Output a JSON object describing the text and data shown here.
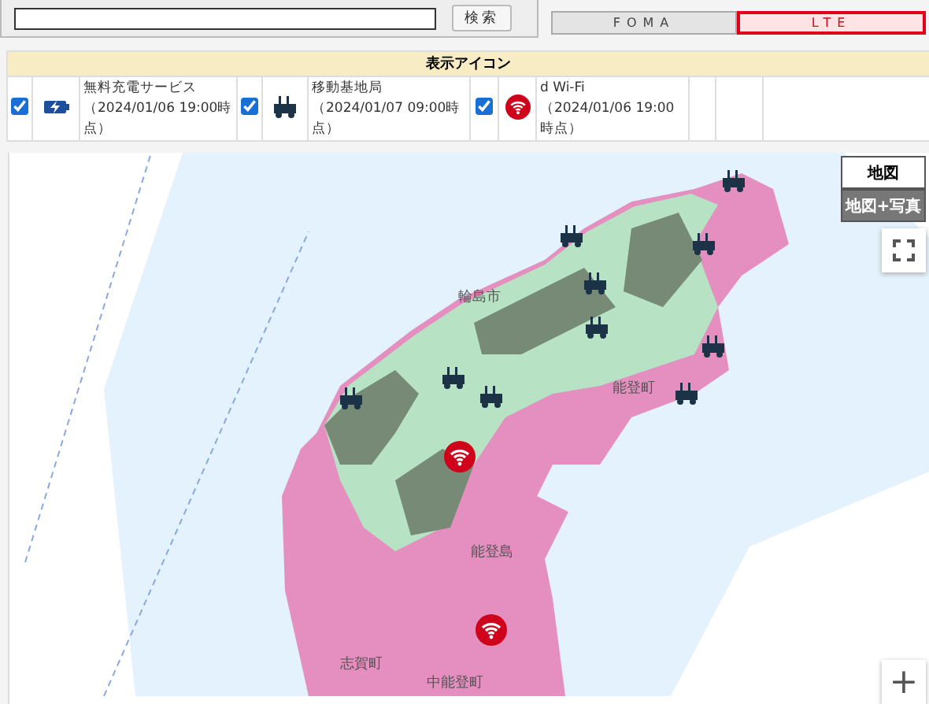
{
  "search": {
    "button": "検索"
  },
  "network_tabs": [
    {
      "label": "FOMA",
      "selected": false
    },
    {
      "label": "LTE",
      "selected": true
    }
  ],
  "legend": {
    "title": "表示アイコン",
    "items": [
      {
        "kind": "charging",
        "checked": true,
        "name": "無料充電サービス",
        "as_of": "（2024/01/06 19:00時点）"
      },
      {
        "kind": "station",
        "checked": true,
        "name": "移動基地局",
        "as_of": "（2024/01/07 09:00時点）"
      },
      {
        "kind": "wifi",
        "checked": true,
        "name": "d Wi-Fi",
        "as_of": "（2024/01/06 19:00時点）"
      }
    ]
  },
  "map": {
    "type_buttons": [
      {
        "label": "地図",
        "selected": true
      },
      {
        "label": "地図+写真",
        "selected": false
      }
    ],
    "place_labels": [
      "輪島市",
      "能登町",
      "能登島",
      "志賀町",
      "中能登町"
    ],
    "zoom_in": "+"
  }
}
